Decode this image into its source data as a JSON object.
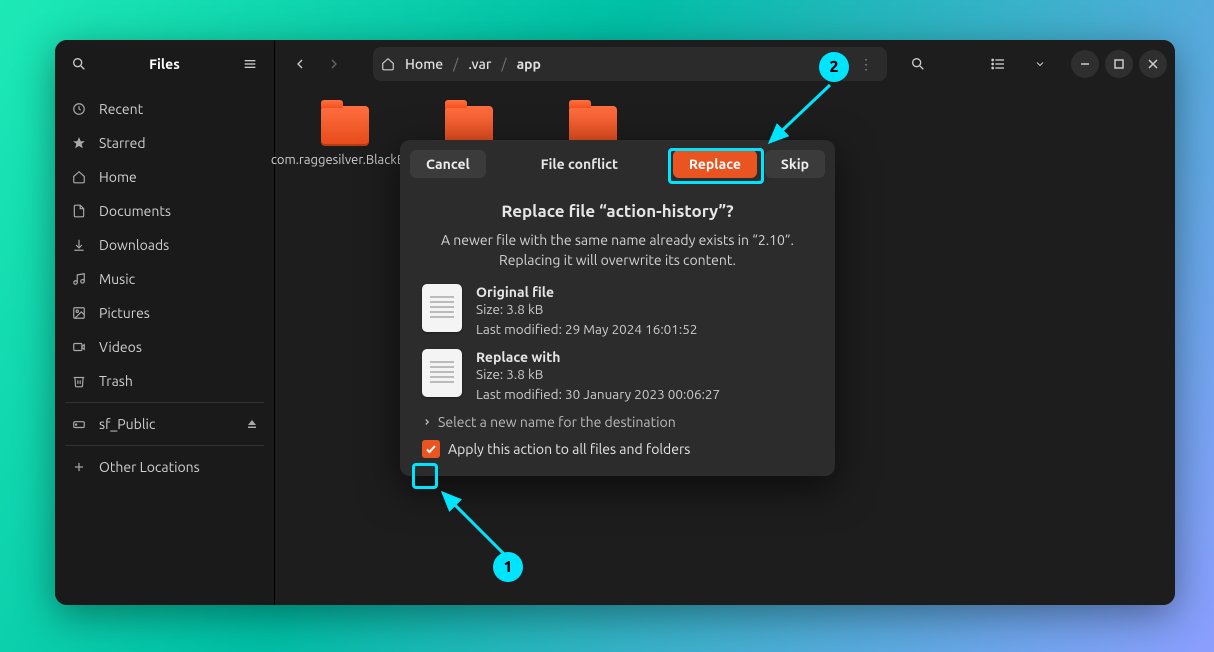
{
  "app_title": "Files",
  "sidebar": {
    "items": [
      {
        "icon": "clock-icon",
        "label": "Recent"
      },
      {
        "icon": "star-icon",
        "label": "Starred"
      },
      {
        "icon": "home-icon",
        "label": "Home"
      },
      {
        "icon": "document-icon",
        "label": "Documents"
      },
      {
        "icon": "download-icon",
        "label": "Downloads"
      },
      {
        "icon": "music-icon",
        "label": "Music"
      },
      {
        "icon": "picture-icon",
        "label": "Pictures"
      },
      {
        "icon": "video-icon",
        "label": "Videos"
      },
      {
        "icon": "trash-icon",
        "label": "Trash"
      }
    ],
    "volume": {
      "icon": "drive-icon",
      "label": "sf_Public"
    },
    "other": {
      "icon": "plus-icon",
      "label": "Other Locations"
    }
  },
  "path": {
    "seg1": "Home",
    "seg2": ".var",
    "seg3": "app",
    "sep": "/"
  },
  "folders": [
    {
      "name": "com.raggesilver.BlackBox"
    },
    {
      "name": ""
    },
    {
      "name": ""
    }
  ],
  "dialog": {
    "cancel": "Cancel",
    "title": "File conflict",
    "replace": "Replace",
    "skip": "Skip",
    "question": "Replace file “action-history”?",
    "sub1": "A newer file with the same name already exists in “2.10”.",
    "sub2": "Replacing it will overwrite its content.",
    "orig_title": "Original file",
    "orig_size": "Size: 3.8 kB",
    "orig_mod": "Last modified: 29 May 2024 16:01:52",
    "repl_title": "Replace with",
    "repl_size": "Size: 3.8 kB",
    "repl_mod": "Last modified: 30 January 2023 00:06:27",
    "select_new": "Select a new name for the destination",
    "apply_all": "Apply this action to all files and folders"
  },
  "annotations": {
    "one": "1",
    "two": "2"
  }
}
